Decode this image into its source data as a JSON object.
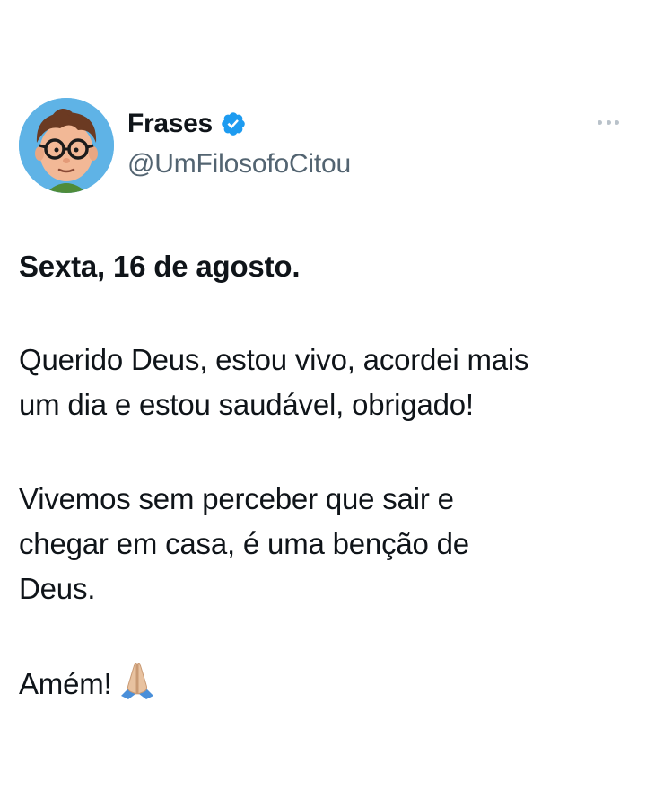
{
  "user": {
    "display_name": "Frases",
    "handle": "@UmFilosofoCitou",
    "verified": true,
    "avatar_icon": "cartoon-boy-with-glasses-avatar",
    "accent_color": "#1d9bf0"
  },
  "menu": {
    "icon": "more-options-icon"
  },
  "post": {
    "date_line": "Sexta, 16 de agosto.",
    "paragraph_1_line_1": "Querido Deus, estou vivo, acordei mais",
    "paragraph_1_line_2": "um dia e estou saudável, obrigado!",
    "paragraph_2_line_1": "Vivemos sem perceber que sair e",
    "paragraph_2_line_2": "chegar em casa, é uma benção de",
    "paragraph_2_line_3": "Deus.",
    "closing": "Amém!",
    "closing_emoji": "praying-hands-icon"
  }
}
